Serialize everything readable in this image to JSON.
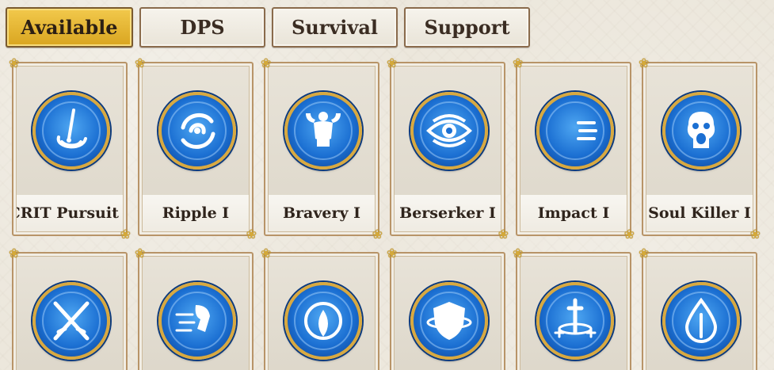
{
  "tabs": [
    {
      "label": "Available",
      "active": true
    },
    {
      "label": "DPS",
      "active": false
    },
    {
      "label": "Survival",
      "active": false
    },
    {
      "label": "Support",
      "active": false
    }
  ],
  "skills_row1": [
    {
      "name": "CRIT Pursuit I",
      "icon": "sword-swirl-icon"
    },
    {
      "name": "Ripple I",
      "icon": "ripple-swirl-icon"
    },
    {
      "name": "Bravery I",
      "icon": "muscle-figure-icon"
    },
    {
      "name": "Berserker I",
      "icon": "eye-icon"
    },
    {
      "name": "Impact I",
      "icon": "crescent-impact-icon"
    },
    {
      "name": "Soul Killer I",
      "icon": "screaming-skull-icon"
    }
  ],
  "skills_row2": [
    {
      "icon": "crossed-swords-icon"
    },
    {
      "icon": "running-figure-icon"
    },
    {
      "icon": "leaf-ring-icon"
    },
    {
      "icon": "shield-orbit-icon"
    },
    {
      "icon": "sword-heal-icon"
    },
    {
      "icon": "water-drop-icon"
    }
  ],
  "colors": {
    "active_tab": "#e0b030",
    "icon_blue": "#1b6fd2",
    "icon_gold_rim": "#d8a941"
  }
}
